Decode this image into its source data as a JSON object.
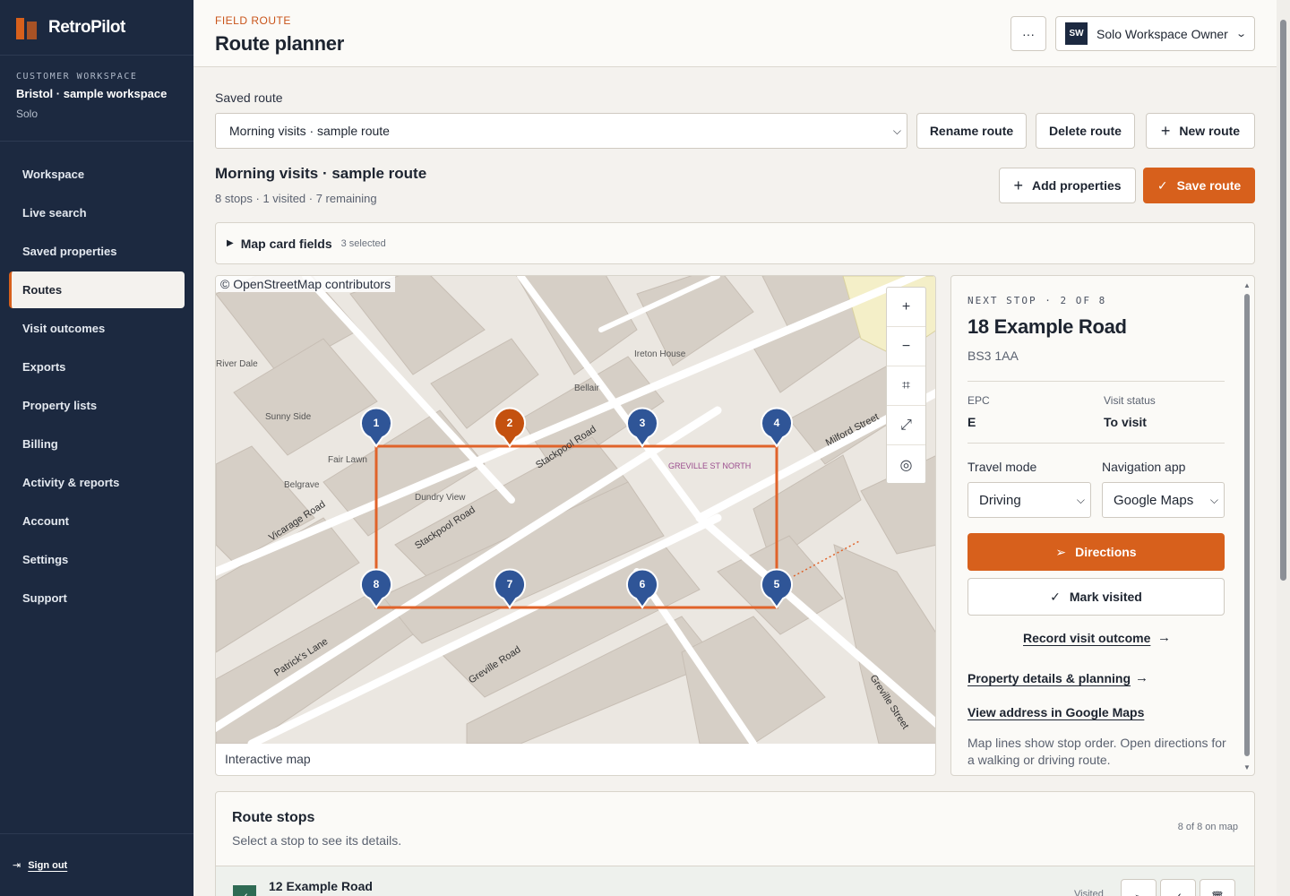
{
  "brand": {
    "name": "RetroPilot"
  },
  "workspace": {
    "kicker": "CUSTOMER WORKSPACE",
    "name": "Bristol · sample workspace",
    "plan": "Solo"
  },
  "nav": {
    "items": [
      {
        "label": "Workspace"
      },
      {
        "label": "Live search"
      },
      {
        "label": "Saved properties"
      },
      {
        "label": "Routes",
        "active": true
      },
      {
        "label": "Visit outcomes"
      },
      {
        "label": "Exports"
      },
      {
        "label": "Property lists"
      },
      {
        "label": "Billing"
      },
      {
        "label": "Activity & reports"
      },
      {
        "label": "Account"
      },
      {
        "label": "Settings"
      },
      {
        "label": "Support"
      }
    ],
    "sign_out": "Sign out"
  },
  "header": {
    "kicker": "FIELD ROUTE",
    "title": "Route planner",
    "more_label": "···",
    "account_initials": "SW",
    "account_name": "Solo Workspace Owner"
  },
  "route_select": {
    "label": "Saved route",
    "value": "Morning visits · sample route",
    "rename": "Rename route",
    "delete": "Delete route",
    "new": "New route"
  },
  "route": {
    "name": "Morning visits · sample route",
    "meta": "8 stops · 1 visited · 7 remaining",
    "add_properties": "Add properties",
    "save": "Save route"
  },
  "fields": {
    "title": "Map card fields",
    "count": "3 selected"
  },
  "map": {
    "attribution": "© OpenStreetMap contributors",
    "caption": "Interactive map",
    "controls": [
      "zoom-in",
      "zoom-out",
      "fit-route",
      "fullscreen",
      "locate"
    ],
    "streets": [
      "Stackpool Road",
      "Stackpool Road",
      "Vicarage Road",
      "Milford Street",
      "Patrick's Lane",
      "Greville Road",
      "Greville Street",
      "Fair Lawn",
      "Belgrave",
      "Dundry View",
      "Bellair",
      "River Dale",
      "Sunny Side",
      "Ireton House",
      "GREVILLE ST NORTH"
    ],
    "pins": [
      {
        "n": "1",
        "visited": false
      },
      {
        "n": "2",
        "visited": false,
        "current": true
      },
      {
        "n": "3",
        "visited": false
      },
      {
        "n": "4",
        "visited": false
      },
      {
        "n": "5",
        "visited": false
      },
      {
        "n": "6",
        "visited": false
      },
      {
        "n": "7",
        "visited": false
      },
      {
        "n": "8",
        "visited": false
      }
    ],
    "colors": {
      "pin": "#2f5597",
      "current": "#c4510f",
      "route": "#e0632a"
    }
  },
  "next_stop": {
    "kicker": "NEXT STOP · 2 OF 8",
    "address": "18 Example Road",
    "postcode": "BS3 1AA",
    "epc_label": "EPC",
    "epc_value": "E",
    "status_label": "Visit status",
    "status_value": "To visit",
    "travel_label": "Travel mode",
    "travel_value": "Driving",
    "nav_label": "Navigation app",
    "nav_value": "Google Maps",
    "directions": "Directions",
    "mark_visited": "Mark visited",
    "record_outcome": "Record visit outcome",
    "property_details": "Property details & planning",
    "view_maps": "View address in Google Maps",
    "note": "Map lines show stop order. Open directions for a walking or driving route."
  },
  "stops": {
    "title": "Route stops",
    "subtitle": "Select a stop to see its details.",
    "count": "8 of 8 on map",
    "rows": [
      {
        "address": "12 Example Road",
        "status": "Visited"
      }
    ]
  }
}
